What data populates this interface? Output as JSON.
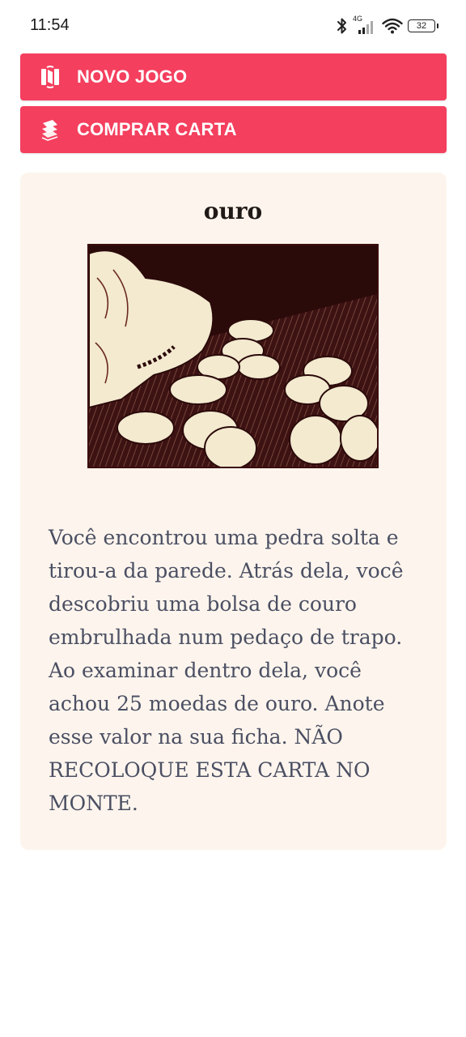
{
  "status_bar": {
    "time": "11:54",
    "network": "4G",
    "battery": "32",
    "icons": [
      "bluetooth-icon",
      "signal-icon",
      "wifi-icon",
      "battery-icon"
    ]
  },
  "actions": {
    "new_game": {
      "label": "NOVO JOGO",
      "icon": "new-game-icon"
    },
    "draw_card": {
      "label": "COMPRAR CARTA",
      "icon": "card-stack-icon"
    }
  },
  "card": {
    "title": "ouro",
    "image": "gold-coins-pouch-illustration",
    "text": "Você encontrou uma pedra solta e tirou-a da parede. Atrás dela, você descobriu uma bolsa de couro embrulhada num pedaço de trapo. Ao examinar dentro dela, você achou 25 moedas de ouro. Anote esse valor na sua ficha. NÃO RECOLOQUE ESTA CARTA NO MONTE."
  },
  "colors": {
    "accent": "#f43f5e",
    "card_background": "#fdf5ed",
    "text": "#4b4f63",
    "illustration_dark": "#2b0a0a",
    "illustration_light": "#f3ead0"
  }
}
